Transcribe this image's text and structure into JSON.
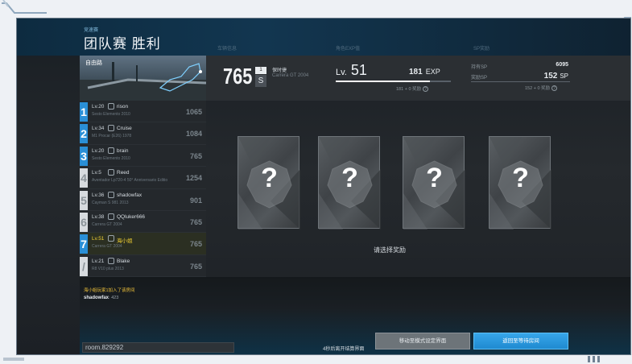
{
  "header": {
    "mode": "竞速赛",
    "title": "团队赛 胜利",
    "col_vehicle": "车辆信息",
    "col_exp": "角色EXP值",
    "col_sp": "SP奖励"
  },
  "map": {
    "label": "自由路"
  },
  "players": [
    {
      "rank": "1",
      "lv": "Lv.20",
      "name": "rison",
      "car": "Sesto Elemento 2010",
      "score": "1065",
      "top": true,
      "me": false
    },
    {
      "rank": "2",
      "lv": "Lv.34",
      "name": "Cruise",
      "car": "M1 Procar (E26) 1978",
      "score": "1084",
      "top": true,
      "me": false
    },
    {
      "rank": "3",
      "lv": "Lv.20",
      "name": "brain",
      "car": "Sesto Elemento 2010",
      "score": "765",
      "top": true,
      "me": false
    },
    {
      "rank": "4",
      "lv": "Lv.5",
      "name": "Reed",
      "car": "Aventador Lp720-4 50° Anniversario Editio",
      "score": "1254",
      "top": false,
      "me": false
    },
    {
      "rank": "5",
      "lv": "Lv.36",
      "name": "shadowfax",
      "car": "Cayman S 981 2013",
      "score": "901",
      "top": false,
      "me": false
    },
    {
      "rank": "6",
      "lv": "Lv.38",
      "name": "QQluker666",
      "car": "Carrera GT 2004",
      "score": "765",
      "top": false,
      "me": false
    },
    {
      "rank": "7",
      "lv": "Lv.51",
      "name": "海小姐",
      "car": "Carrera GT 2004",
      "score": "765",
      "top": false,
      "me": true
    },
    {
      "rank": "/",
      "lv": "Lv.21",
      "name": "Blake",
      "car": "R8 V10 plus 2013",
      "score": "765",
      "top": false,
      "me": false
    }
  ],
  "stats": {
    "score": "765",
    "rank_top": "1",
    "rank_grade": "S",
    "driver": "保时捷",
    "car": "Carrera GT 2004",
    "level_prefix": "Lv.",
    "level": "51",
    "exp_value": "181",
    "exp_unit": "EXP",
    "exp_progress": 0.82,
    "exp_gain": "181 + 0 奖励",
    "sp_have_label": "持有SP",
    "sp_have_value": "6095",
    "sp_reward_label": "奖励SP",
    "sp_reward_value": "152",
    "sp_unit": "SP",
    "sp_gain": "152 + 0 奖励",
    "help_glyph": "?"
  },
  "rewards": {
    "cards": [
      {
        "symbol": "?"
      },
      {
        "symbol": "?"
      },
      {
        "symbol": "?"
      },
      {
        "symbol": "?"
      }
    ],
    "prompt": "请选择奖励"
  },
  "chat": {
    "system": "海小姐玩家1加入了该房间",
    "user": "shadowfax",
    "message": ": 423"
  },
  "footer": {
    "room": "room.829292",
    "countdown": "4秒后离开结算界面",
    "btn_mode": "移动至模式设定界面",
    "btn_room": "返回至等待房间"
  },
  "colors": {
    "accent_blue": "#2a8fd6",
    "highlight_yellow": "#f3d233"
  }
}
